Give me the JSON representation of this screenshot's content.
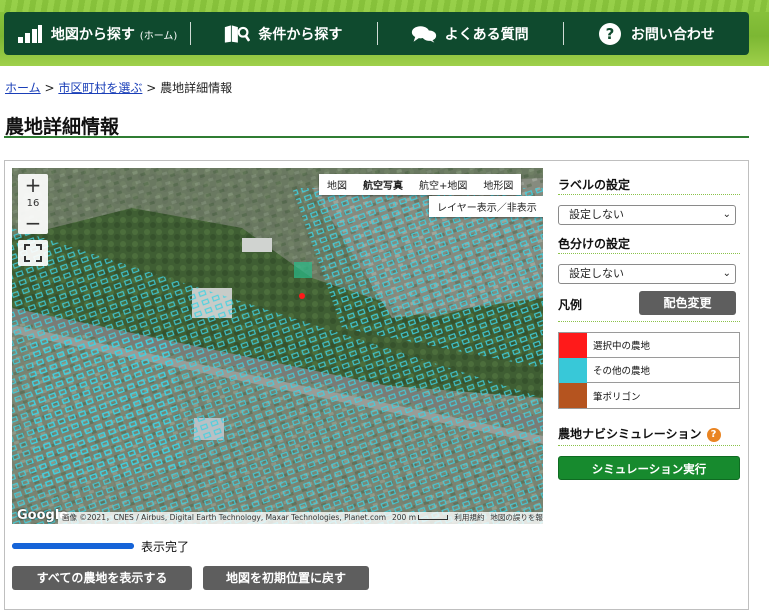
{
  "nav": {
    "items": [
      {
        "label": "地図から探す",
        "sub": "(ホーム)",
        "icon": "bar-chart-icon"
      },
      {
        "label": "条件から探す",
        "sub": "",
        "icon": "book-search-icon"
      },
      {
        "label": "よくある質問",
        "sub": "",
        "icon": "chat-bubbles-icon"
      },
      {
        "label": "お問い合わせ",
        "sub": "",
        "icon": "question-circle-icon"
      }
    ]
  },
  "breadcrumb": {
    "home": "ホーム",
    "city": "市区町村を選ぶ",
    "current": "農地詳細情報",
    "separator": ">"
  },
  "page_title": "農地詳細情報",
  "map": {
    "zoom_in": "+",
    "zoom_out": "−",
    "zoom_level": "16",
    "map_types": [
      "地図",
      "航空写真",
      "航空+地図",
      "地形図"
    ],
    "active_map_type": "航空写真",
    "layer_toggle": "レイヤー表示／非表示",
    "google": "Google",
    "attribution": "画像 ©2021，CNES / Airbus, Digital Earth Technology, Maxar Technologies, Planet.com",
    "scale": "200 m",
    "terms": "利用規約",
    "report": "地図の誤りを報告する"
  },
  "sidebar": {
    "label_setting": "ラベルの設定",
    "label_select": "設定しない",
    "color_setting": "色分けの設定",
    "color_select": "設定しない",
    "legend_title": "凡例",
    "color_change": "配色変更",
    "legend": [
      {
        "label": "選択中の農地",
        "color": "#ff1a1a"
      },
      {
        "label": "その他の農地",
        "color": "#38c8d8"
      },
      {
        "label": "筆ポリゴン",
        "color": "#b5541f"
      }
    ],
    "simulation_title": "農地ナビシミュレーション",
    "simulation_button": "シミュレーション実行"
  },
  "progress": {
    "value": 1.0,
    "label": "表示完了"
  },
  "bottom": {
    "show_all": "すべての農地を表示する",
    "reset_map": "地図を初期位置に戻す"
  },
  "colors": {
    "nav_bg": "#0f4a2e",
    "banner": "#8cc63f",
    "accent_green": "#178a2e",
    "link": "#1a3fb8",
    "parcel": "#38c8d8"
  }
}
